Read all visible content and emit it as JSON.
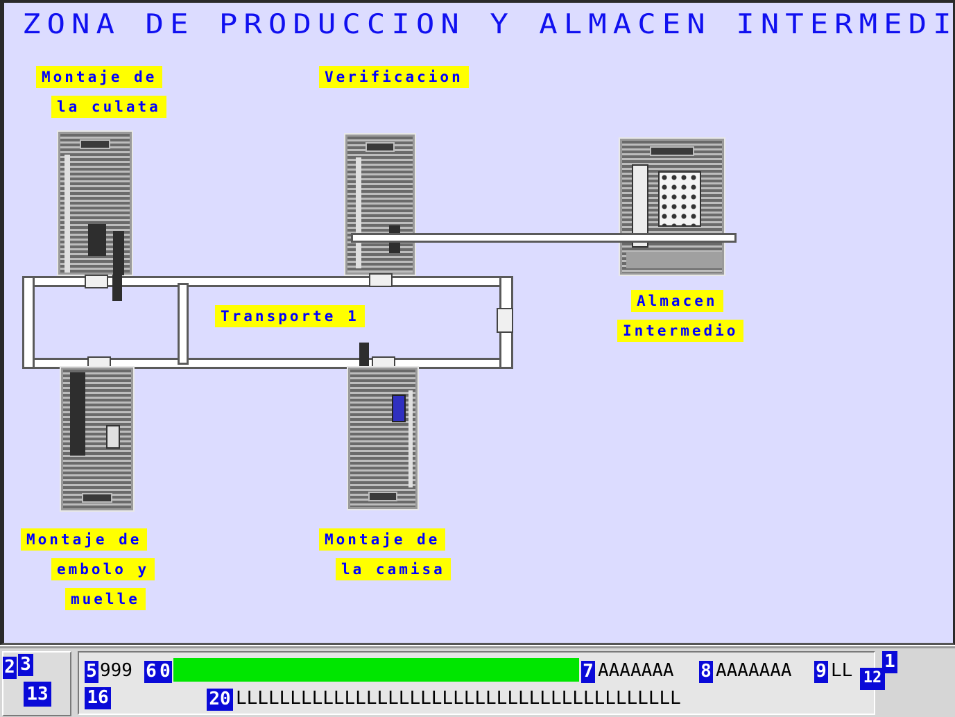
{
  "title": "ZONA DE PRODUCCION Y ALMACEN INTERMEDIO",
  "labels": {
    "culata_1": "Montaje de",
    "culata_2": "la culata",
    "verificacion": "Verificacion",
    "almacen_1": "Almacen",
    "almacen_2": "Intermedio",
    "transporte": "Transporte 1",
    "embolo_1": "Montaje de",
    "embolo_2": "embolo y",
    "embolo_3": "muelle",
    "camisa_1": "Montaje de",
    "camisa_2": "la camisa"
  },
  "status": {
    "tag_2": "2",
    "tag_3": "3",
    "tag_13": "13",
    "tag_5": "5",
    "value_5": "999",
    "tag_6": "6",
    "tag_0": "0",
    "tag_7": "7",
    "value_7": "AAAAAAA",
    "tag_8": "8",
    "value_8": "AAAAAAA",
    "tag_9": "9",
    "value_9": "LL",
    "tag_1": "1",
    "tag_12": "12",
    "tag_16": "16",
    "tag_20": "20",
    "value_20": "LLLLLLLLLLLLLLLLLLLLLLLLLLLLLLLLLLLLLLLLL"
  },
  "colors": {
    "background": "#dcdcff",
    "title": "#1010f0",
    "label_bg": "#ffff00",
    "label_fg": "#0000ff",
    "tag_bg": "#0a0ad8",
    "progress": "#00e600"
  }
}
